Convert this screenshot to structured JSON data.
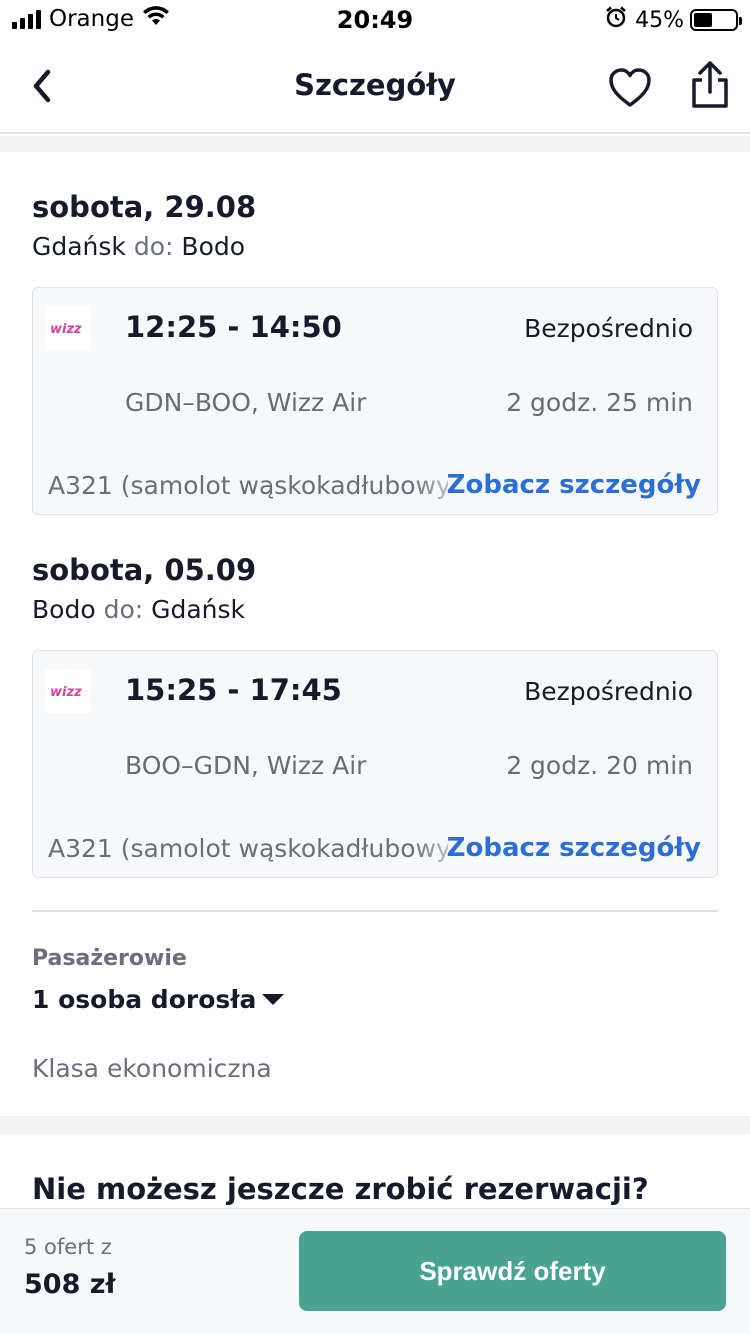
{
  "status_bar": {
    "carrier": "Orange",
    "time": "20:49",
    "battery": "45%",
    "battery_level": 0.45
  },
  "nav": {
    "title": "Szczegóły",
    "icons": [
      "chevron-left-icon",
      "heart-icon",
      "share-icon"
    ]
  },
  "outbound": {
    "date": "sobota, 29.08",
    "from": "Gdańsk",
    "to_word": "do:",
    "to": "Bodo",
    "airline_logo": "wizz",
    "times": "12:25 - 14:50",
    "stops": "Bezpośrednio",
    "route": "GDN–BOO, Wizz Air",
    "duration": "2 godz. 25 min",
    "aircraft": "A321 (samolot wąskokadłubowy)",
    "details_link": "Zobacz szczegóły"
  },
  "inbound": {
    "date": "sobota, 05.09",
    "from": "Bodo",
    "to_word": "do:",
    "to": "Gdańsk",
    "airline_logo": "wizz",
    "times": "15:25 - 17:45",
    "stops": "Bezpośrednio",
    "route": "BOO–GDN, Wizz Air",
    "duration": "2 godz. 20 min",
    "aircraft": "A321 (samolot wąskokadłubowy)",
    "details_link": "Zobacz szczegóły"
  },
  "passengers": {
    "label": "Pasażerowie",
    "value": "1 osoba dorosła",
    "cabin_class": "Klasa ekonomiczna"
  },
  "promo": {
    "title": "Nie możesz jeszcze zrobić rezerwacji?"
  },
  "footer": {
    "offers_count": "5 ofert z",
    "price": "508 zł",
    "cta_label": "Sprawdź oferty"
  },
  "colors": {
    "accent_link": "#2b6fd6",
    "cta_bg": "#4aa391",
    "wizz_logo": "#d6409f"
  }
}
